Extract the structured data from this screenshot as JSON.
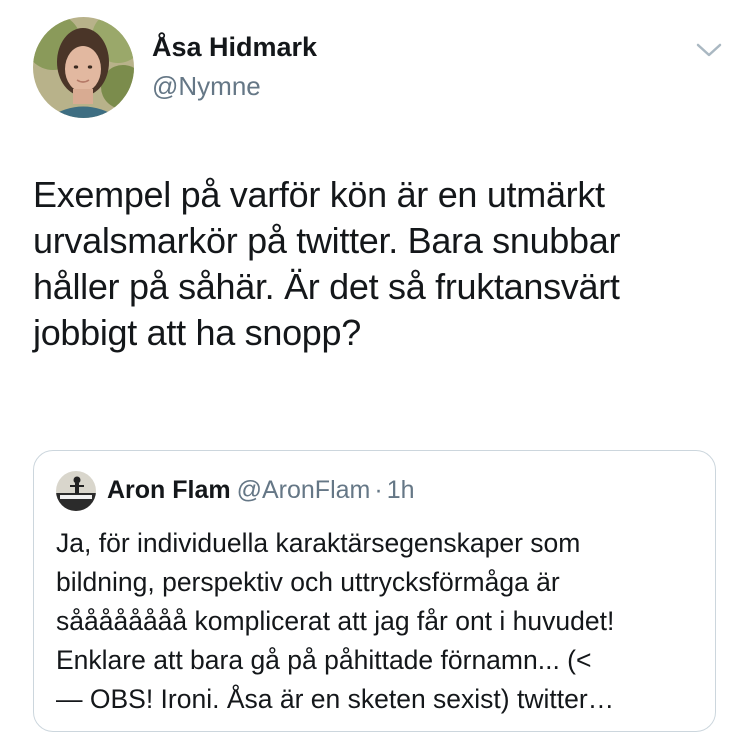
{
  "author": {
    "display_name": "Åsa Hidmark",
    "handle": "@Nymne",
    "avatar_icon": "profile-photo"
  },
  "menu_icon": "chevron-down-icon",
  "tweet": {
    "lines": [
      "Exempel på varför kön är en utmärkt",
      "urvalsmarkör på twitter. Bara snubbar",
      "håller på såhär. Är det så fruktansvärt",
      "jobbigt att ha snopp?"
    ]
  },
  "quoted_tweet": {
    "display_name": "Aron Flam",
    "handle": "@AronFlam",
    "separator": "·",
    "time": "1h",
    "lines": [
      "Ja, för individuella karaktärsegenskaper som",
      "bildning, perspektiv och uttrycksförmåga är",
      "såååååååå komplicerat att jag får ont i huvudet!",
      "Enklare att bara gå på påhittade förnamn... (<",
      "— OBS! Ironi. Åsa är en sketen sexist) twitter…"
    ]
  },
  "colors": {
    "text": "#14171a",
    "secondary": "#657786",
    "border": "#ccd6dd"
  }
}
